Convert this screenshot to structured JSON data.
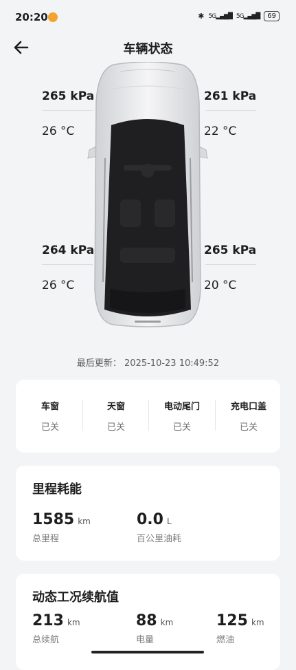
{
  "status_bar": {
    "time": "20:20",
    "icons": [
      "bluetooth-icon",
      "signal-5g-icon",
      "signal-5g-icon"
    ],
    "sig1": "5G",
    "sig2": "5G",
    "battery": "69"
  },
  "header": {
    "title": "车辆状态",
    "back_icon": "back-arrow-icon"
  },
  "tires": {
    "front_left": {
      "pressure": "265 kPa",
      "temp": "26 °C"
    },
    "front_right": {
      "pressure": "261 kPa",
      "temp": "22 °C"
    },
    "rear_left": {
      "pressure": "264 kPa",
      "temp": "26 °C"
    },
    "rear_right": {
      "pressure": "265 kPa",
      "temp": "20 °C"
    }
  },
  "last_update": "最后更新： 2025-10-23 10:49:52",
  "status_items": [
    {
      "label": "车窗",
      "value": "已关"
    },
    {
      "label": "天窗",
      "value": "已关"
    },
    {
      "label": "电动尾门",
      "value": "已关"
    },
    {
      "label": "充电口盖",
      "value": "已关"
    }
  ],
  "mileage": {
    "title": "里程耗能",
    "total": {
      "value": "1585",
      "unit": "km",
      "caption": "总里程"
    },
    "fuel": {
      "value": "0.0",
      "unit": "L",
      "caption": "百公里油耗"
    }
  },
  "range": {
    "title": "动态工况续航值",
    "total": {
      "value": "213",
      "unit": "km",
      "caption": "总续航"
    },
    "electric": {
      "value": "88",
      "unit": "km",
      "caption": "电量"
    },
    "fuel": {
      "value": "125",
      "unit": "km",
      "caption": "燃油"
    }
  },
  "colors": {
    "background": "#f3f4f6",
    "card": "#ffffff",
    "text": "#1e1e1e",
    "muted": "#7a7a7a"
  }
}
